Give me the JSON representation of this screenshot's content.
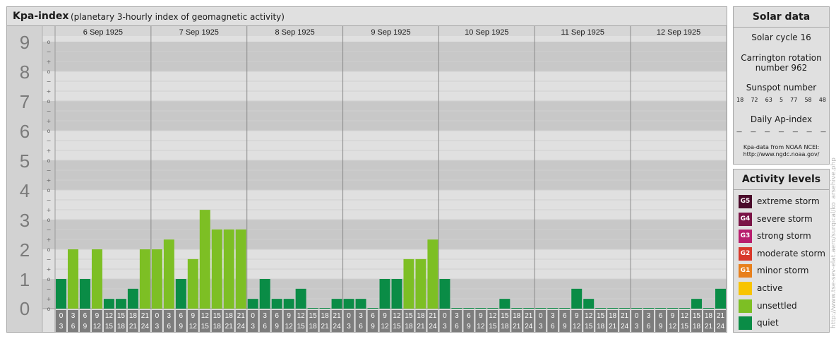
{
  "header": {
    "title": "Kpa-index",
    "subtitle": "(planetary 3-hourly index of geomagnetic activity)"
  },
  "chart_data": {
    "type": "bar",
    "ylim": [
      0,
      9
    ],
    "y_ticks": [
      "0",
      "1",
      "2",
      "3",
      "4",
      "5",
      "6",
      "7",
      "8",
      "9"
    ],
    "minor_tick_marks": [
      "o",
      "+",
      "−"
    ],
    "days": [
      "6 Sep 1925",
      "7 Sep 1925",
      "8 Sep 1925",
      "9 Sep 1925",
      "10 Sep 1925",
      "11 Sep 1925",
      "12 Sep 1925"
    ],
    "hour_labels": [
      [
        "0",
        "3"
      ],
      [
        "3",
        "6"
      ],
      [
        "6",
        "9"
      ],
      [
        "9",
        "12"
      ],
      [
        "12",
        "15"
      ],
      [
        "15",
        "18"
      ],
      [
        "18",
        "21"
      ],
      [
        "21",
        "24"
      ]
    ],
    "values": [
      [
        1.0,
        2.0,
        1.0,
        2.0,
        0.33,
        0.33,
        0.67,
        2.0
      ],
      [
        2.0,
        2.33,
        1.0,
        1.67,
        3.33,
        2.67,
        2.67,
        2.67
      ],
      [
        0.33,
        1.0,
        0.33,
        0.33,
        0.67,
        0.0,
        0.0,
        0.33
      ],
      [
        0.33,
        0.33,
        0.0,
        1.0,
        1.0,
        1.67,
        1.67,
        2.33
      ],
      [
        1.0,
        0.0,
        0.0,
        0.0,
        0.0,
        0.33,
        0.0,
        0.0
      ],
      [
        0.0,
        0.0,
        0.0,
        0.67,
        0.33,
        0.0,
        0.0,
        0.0
      ],
      [
        0.0,
        0.0,
        0.0,
        0.0,
        0.0,
        0.33,
        0.0,
        0.67
      ]
    ],
    "colors": {
      "quiet": "#0a8c46",
      "unsettled": "#7dbf24",
      "active": "#f8c400",
      "band_dark": "#c8c8c8",
      "band_light": "#e0e0e0",
      "label_cell": "#7d7d7d"
    }
  },
  "solar": {
    "title": "Solar data",
    "cycle": "Solar cycle 16",
    "carrington_1": "Carrington rotation",
    "carrington_2": "number 962",
    "sunspot_title": "Sunspot number",
    "sunspots": [
      "18",
      "72",
      "63",
      "5",
      "77",
      "58",
      "48"
    ],
    "ap_title": "Daily Ap-index",
    "ap_values": [
      "—",
      "—",
      "—",
      "—",
      "—",
      "—",
      "—"
    ],
    "source_1": "Kpa-data from NOAA NCEI:",
    "source_2": "http://www.ngdc.noaa.gov/"
  },
  "activity": {
    "title": "Activity levels",
    "items": [
      {
        "code": "G5",
        "label": "extreme storm",
        "color": "#4a0a2a"
      },
      {
        "code": "G4",
        "label": "severe storm",
        "color": "#7a1446"
      },
      {
        "code": "G3",
        "label": "strong storm",
        "color": "#b81e6e"
      },
      {
        "code": "G2",
        "label": "moderate storm",
        "color": "#d8382a"
      },
      {
        "code": "G1",
        "label": "minor storm",
        "color": "#e8801c"
      },
      {
        "code": "",
        "label": "active",
        "color": "#f8c400"
      },
      {
        "code": "",
        "label": "unsettled",
        "color": "#7dbf24"
      },
      {
        "code": "",
        "label": "quiet",
        "color": "#0a8c46"
      }
    ]
  },
  "watermark": "http://www.tse-sev-elat.aero/surgical/ko_arsehive.php"
}
